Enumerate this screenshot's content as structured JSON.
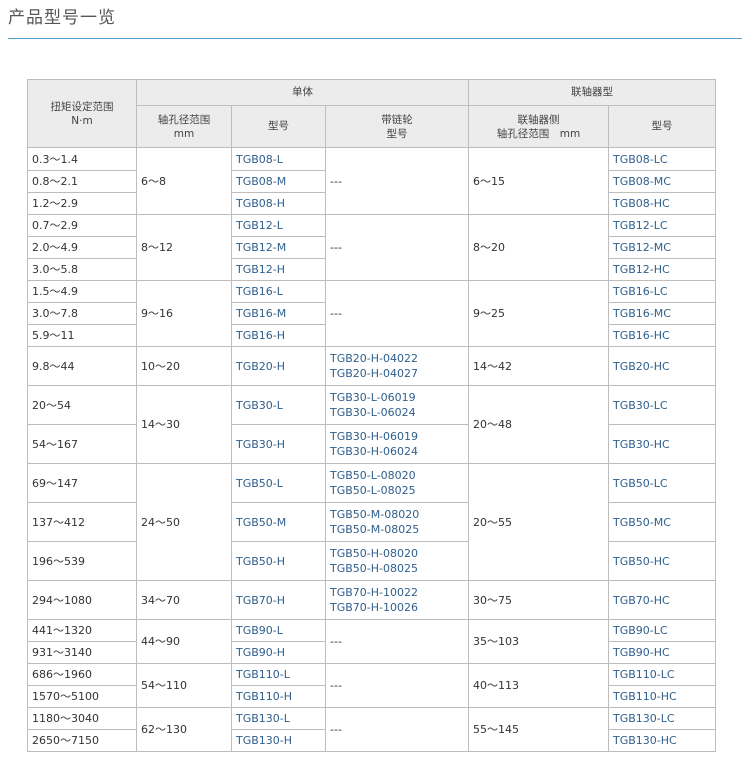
{
  "page": {
    "title": "产品型号一览"
  },
  "table": {
    "headers": {
      "torque": "扭矩设定范围",
      "torque_unit": "N·m",
      "single": "单体",
      "coupling": "联轴器型",
      "bore": "轴孔径范围",
      "bore_unit": "mm",
      "model": "型号",
      "sprocket": "带链轮",
      "sprocket_model": "型号",
      "coupling_side": "联轴器侧",
      "coupling_bore": "轴孔径范围　mm",
      "coupling_model": "型号"
    },
    "rows": [
      {
        "torque": "0.3～1.4",
        "bore": "6～8",
        "model": "TGB08-L",
        "sprocket": "---",
        "cbore": "6～15",
        "cmodel": "TGB08-LC"
      },
      {
        "torque": "0.8～2.1",
        "model": "TGB08-M",
        "cmodel": "TGB08-MC"
      },
      {
        "torque": "1.2～2.9",
        "model": "TGB08-H",
        "cmodel": "TGB08-HC"
      },
      {
        "torque": "0.7～2.9",
        "bore": "8～12",
        "model": "TGB12-L",
        "sprocket": "---",
        "cbore": "8～20",
        "cmodel": "TGB12-LC"
      },
      {
        "torque": "2.0～4.9",
        "model": "TGB12-M",
        "cmodel": "TGB12-MC"
      },
      {
        "torque": "3.0～5.8",
        "model": "TGB12-H",
        "cmodel": "TGB12-HC"
      },
      {
        "torque": "1.5～4.9",
        "bore": "9～16",
        "model": "TGB16-L",
        "sprocket": "---",
        "cbore": "9～25",
        "cmodel": "TGB16-LC"
      },
      {
        "torque": "3.0～7.8",
        "model": "TGB16-M",
        "cmodel": "TGB16-MC"
      },
      {
        "torque": "5.9～11",
        "model": "TGB16-H",
        "cmodel": "TGB16-HC"
      },
      {
        "torque": "9.8～44",
        "bore": "10～20",
        "model": "TGB20-H",
        "sprocket": [
          "TGB20-H-04022",
          "TGB20-H-04027"
        ],
        "cbore": "14～42",
        "cmodel": "TGB20-HC"
      },
      {
        "torque": "20～54",
        "bore": "14～30",
        "model": "TGB30-L",
        "sprocket": [
          "TGB30-L-06019",
          "TGB30-L-06024"
        ],
        "cbore": "20～48",
        "cmodel": "TGB30-LC"
      },
      {
        "torque": "54～167",
        "model": "TGB30-H",
        "sprocket": [
          "TGB30-H-06019",
          "TGB30-H-06024"
        ],
        "cmodel": "TGB30-HC"
      },
      {
        "torque": "69～147",
        "bore": "24～50",
        "model": "TGB50-L",
        "sprocket": [
          "TGB50-L-08020",
          "TGB50-L-08025"
        ],
        "cbore": "20～55",
        "cmodel": "TGB50-LC"
      },
      {
        "torque": "137～412",
        "model": "TGB50-M",
        "sprocket": [
          "TGB50-M-08020",
          "TGB50-M-08025"
        ],
        "cmodel": "TGB50-MC"
      },
      {
        "torque": "196～539",
        "model": "TGB50-H",
        "sprocket": [
          "TGB50-H-08020",
          "TGB50-H-08025"
        ],
        "cmodel": "TGB50-HC"
      },
      {
        "torque": "294～1080",
        "bore": "34～70",
        "model": "TGB70-H",
        "sprocket": [
          "TGB70-H-10022",
          "TGB70-H-10026"
        ],
        "cbore": "30～75",
        "cmodel": "TGB70-HC"
      },
      {
        "torque": "441～1320",
        "bore": "44～90",
        "model": "TGB90-L",
        "sprocket": "---",
        "cbore": "35～103",
        "cmodel": "TGB90-LC"
      },
      {
        "torque": "931～3140",
        "model": "TGB90-H",
        "cmodel": "TGB90-HC"
      },
      {
        "torque": "686～1960",
        "bore": "54～110",
        "model": "TGB110-L",
        "sprocket": "---",
        "cbore": "40～113",
        "cmodel": "TGB110-LC"
      },
      {
        "torque": "1570～5100",
        "model": "TGB110-H",
        "cmodel": "TGB110-HC"
      },
      {
        "torque": "1180～3040",
        "bore": "62～130",
        "model": "TGB130-L",
        "sprocket": "---",
        "cbore": "55～145",
        "cmodel": "TGB130-LC"
      },
      {
        "torque": "2650～7150",
        "model": "TGB130-H",
        "cmodel": "TGB130-HC"
      }
    ]
  }
}
